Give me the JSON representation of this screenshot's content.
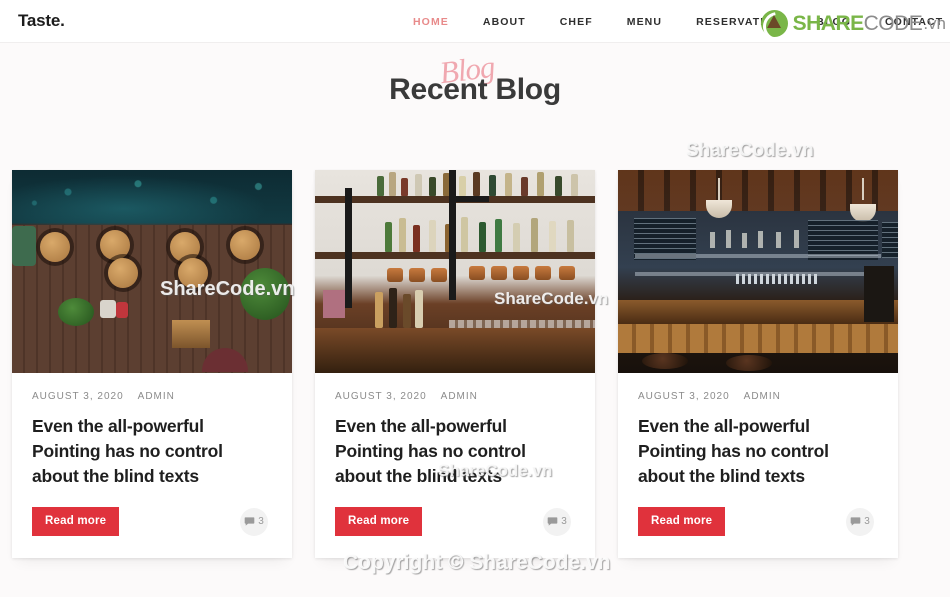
{
  "header": {
    "brand": "Taste.",
    "nav": [
      {
        "label": "HOME",
        "active": true
      },
      {
        "label": "ABOUT",
        "active": false
      },
      {
        "label": "CHEF",
        "active": false
      },
      {
        "label": "MENU",
        "active": false
      },
      {
        "label": "RESERVATION",
        "active": false
      },
      {
        "label": "BLOG",
        "active": false
      },
      {
        "label": "CONTACT",
        "active": false
      }
    ]
  },
  "page": {
    "title_script": "Blog",
    "title_main": "Recent Blog"
  },
  "posts": [
    {
      "date": "AUGUST 3, 2020",
      "author": "ADMIN",
      "title": "Even the all-powerful Pointing has no control about the blind texts",
      "button": "Read more",
      "comments": "3",
      "image_alt": "aerial-view-restaurant-patio-tables"
    },
    {
      "date": "AUGUST 3, 2020",
      "author": "ADMIN",
      "title": "Even the all-powerful Pointing has no control about the blind texts",
      "button": "Read more",
      "comments": "3",
      "image_alt": "bar-shelves-bottles-copper-mugs"
    },
    {
      "date": "AUGUST 3, 2020",
      "author": "ADMIN",
      "title": "Even the all-powerful Pointing has no control about the blind texts",
      "button": "Read more",
      "comments": "3",
      "image_alt": "pub-interior-pendant-lights-bar-stools"
    }
  ],
  "watermarks": {
    "card1": "ShareCode.vn",
    "card2": "ShareCode.vn",
    "top_right_area": "ShareCode.vn",
    "mid_lower": "ShareCode.vn",
    "footer": "Copyright © ShareCode.vn",
    "logo": {
      "part1": "SHARE",
      "part2": "CODE",
      "part3": ".vn"
    }
  },
  "colors": {
    "accent_red": "#e0323c",
    "nav_active": "#e88a8a",
    "script_pink": "#f0a8b0",
    "logo_green": "#7ab648",
    "page_bg": "#fcfafa"
  }
}
